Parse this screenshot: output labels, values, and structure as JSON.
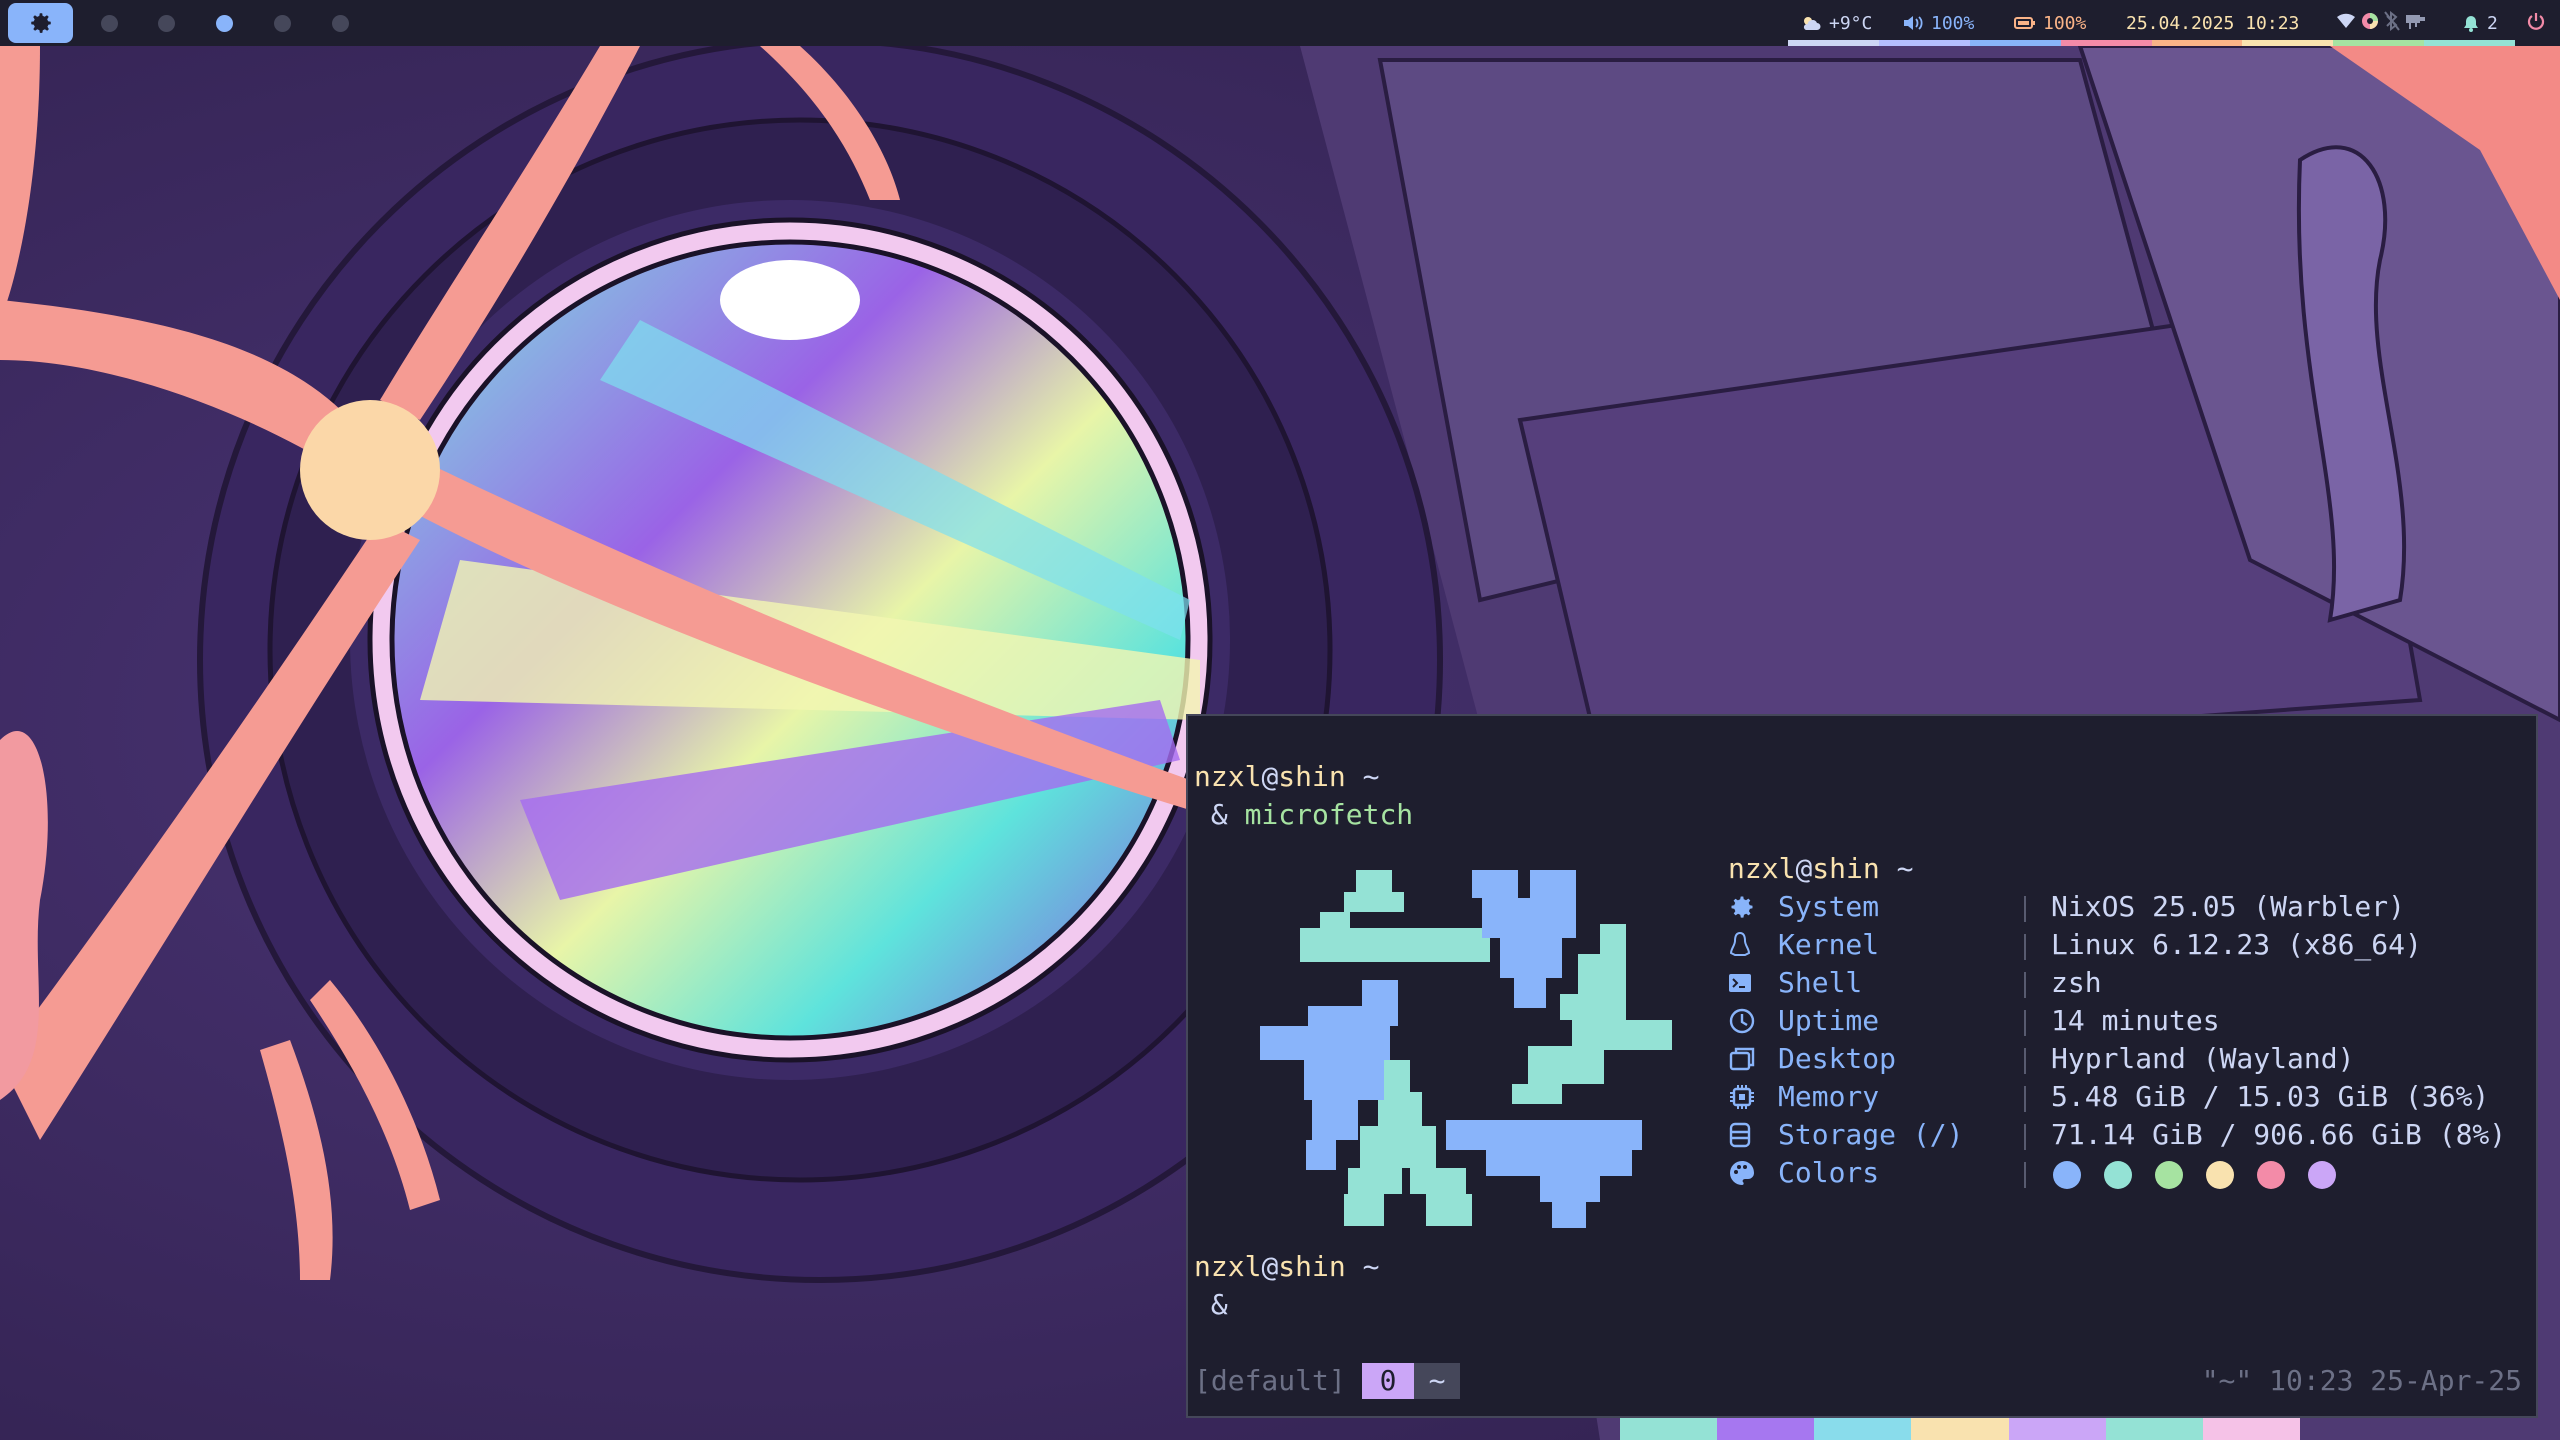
{
  "topbar": {
    "workspaces": [
      {
        "id": 1,
        "active": false
      },
      {
        "id": 2,
        "active": false
      },
      {
        "id": 3,
        "active": true
      },
      {
        "id": 4,
        "active": false
      },
      {
        "id": 5,
        "active": false
      }
    ],
    "weather": {
      "icon": "cloud-sun-icon",
      "text": "+9°C"
    },
    "volume": {
      "icon": "speaker-icon",
      "text": "100%"
    },
    "battery": {
      "icon": "battery-icon",
      "text": "100%"
    },
    "clock": {
      "text": "25.04.2025 10:23"
    },
    "tray_icons": [
      "wifi-icon",
      "color-wheel-icon",
      "bluetooth-off-icon",
      "usb-icon"
    ],
    "notifications": {
      "icon": "bell-icon",
      "text": "2"
    },
    "power": {
      "icon": "power-icon"
    },
    "colors": {
      "bar_bg": "#1e1e2e",
      "accent_blue": "#89b4fa",
      "underline": [
        "#cdd6f4",
        "#b4befe",
        "#89b4fa",
        "#f38ba8",
        "#fab387",
        "#f9e2af",
        "#a6e3a1",
        "#94e2d5"
      ]
    }
  },
  "terminal": {
    "prompt1": {
      "user": "nzxl",
      "at": "@",
      "host": "shin",
      "cwd": " ~"
    },
    "command_prefix": " & ",
    "command": "microfetch",
    "fetch_header": {
      "user": "nzxl",
      "at": "@",
      "host": "shin",
      "cwd": " ~"
    },
    "fetch_rows": [
      {
        "icon": "gear-icon",
        "key": "System",
        "value": "NixOS 25.05 (Warbler)"
      },
      {
        "icon": "penguin-icon",
        "key": "Kernel",
        "value": "Linux 6.12.23 (x86_64)"
      },
      {
        "icon": "terminal-prompt-icon",
        "key": "Shell",
        "value": "zsh"
      },
      {
        "icon": "clock-icon",
        "key": "Uptime",
        "value": "14 minutes"
      },
      {
        "icon": "window-icon",
        "key": "Desktop",
        "value": "Hyprland (Wayland)"
      },
      {
        "icon": "cpu-chip-icon",
        "key": "Memory",
        "value": "5.48 GiB / 15.03 GiB (36%)"
      },
      {
        "icon": "database-icon",
        "key": "Storage (/)",
        "value": "71.14 GiB / 906.66 GiB (8%)"
      },
      {
        "icon": "palette-icon",
        "key": "Colors",
        "value": ""
      }
    ],
    "color_dots": [
      "#89b4fa",
      "#94e2d5",
      "#a6e3a1",
      "#f9e2af",
      "#f38ba8",
      "#cba6f7"
    ],
    "prompt2": {
      "user": "nzxl",
      "at": "@",
      "host": "shin",
      "cwd": " ~"
    },
    "prompt2_prefix": " &",
    "logo": {
      "icon": "nixos-snowflake-logo",
      "colors": [
        "#94e2d5",
        "#89b4fa"
      ]
    },
    "tmux": {
      "session": "[default]",
      "window_index": "0",
      "window_name": "~",
      "right": "\"~\" 10:23 25-Apr-25"
    }
  }
}
